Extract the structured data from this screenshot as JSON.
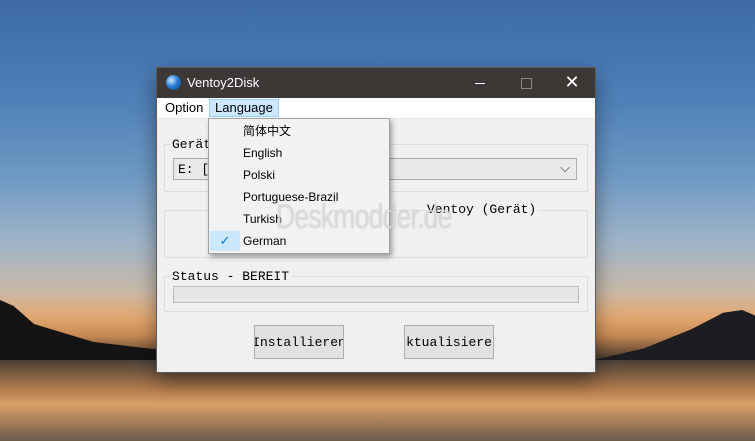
{
  "window": {
    "title": "Ventoy2Disk",
    "buttons": {
      "minimize": "minimize",
      "maximize": "maximize",
      "close": "✕"
    }
  },
  "menubar": {
    "option": "Option",
    "language": "Language"
  },
  "language_menu": {
    "items": [
      {
        "label": "简体中文",
        "checked": false
      },
      {
        "label": "English",
        "checked": false
      },
      {
        "label": "Polski",
        "checked": false
      },
      {
        "label": "Portuguese-Brazil",
        "checked": false
      },
      {
        "label": "Turkish",
        "checked": false
      },
      {
        "label": "German",
        "checked": true
      }
    ],
    "check_mark": "✓"
  },
  "device": {
    "label": "Gerät",
    "selected_value": "E: [",
    "chevron": "⌵"
  },
  "ventoy": {
    "label": "Ventoy (Gerät)"
  },
  "status": {
    "label": "Status - BEREIT",
    "progress": 0
  },
  "actions": {
    "install": "Installieren",
    "update": "ktualisiere"
  },
  "watermark": "Deskmodder.de",
  "colors": {
    "titlebar": "#3c3836",
    "menu_highlight": "#cce8ff",
    "check_blue": "#0078d7"
  }
}
